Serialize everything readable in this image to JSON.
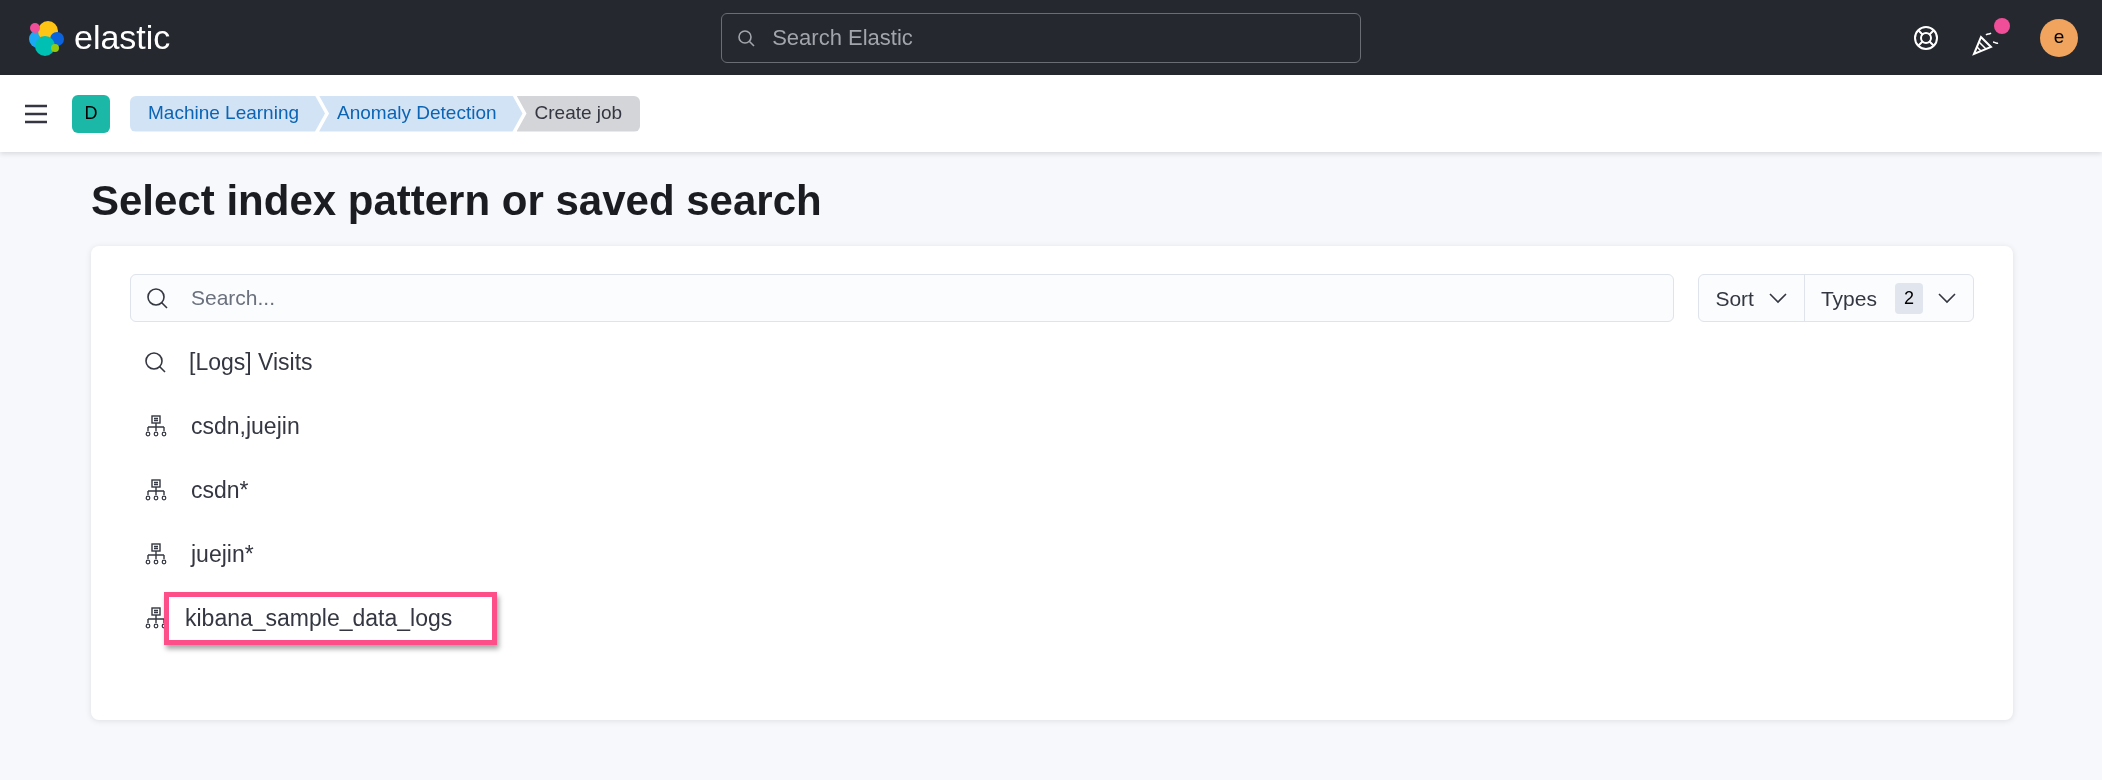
{
  "header": {
    "brand": "elastic",
    "search": {
      "placeholder": "Search Elastic"
    },
    "news_unread": true,
    "avatar": "e"
  },
  "nav": {
    "space": "D",
    "breadcrumbs": [
      {
        "label": "Machine Learning",
        "current": false
      },
      {
        "label": "Anomaly Detection",
        "current": false
      },
      {
        "label": "Create job",
        "current": true
      }
    ]
  },
  "title": "Select index pattern or saved search",
  "search": {
    "placeholder": "Search..."
  },
  "sort": {
    "label": "Sort"
  },
  "types": {
    "label": "Types",
    "count": "2"
  },
  "items": [
    {
      "kind": "saved_search",
      "label": "[Logs] Visits",
      "highlighted": false
    },
    {
      "kind": "index_pattern",
      "label": "csdn,juejin",
      "highlighted": false
    },
    {
      "kind": "index_pattern",
      "label": "csdn*",
      "highlighted": false
    },
    {
      "kind": "index_pattern",
      "label": "juejin*",
      "highlighted": false
    },
    {
      "kind": "index_pattern",
      "label": "kibana_sample_data_logs",
      "highlighted": true
    }
  ]
}
